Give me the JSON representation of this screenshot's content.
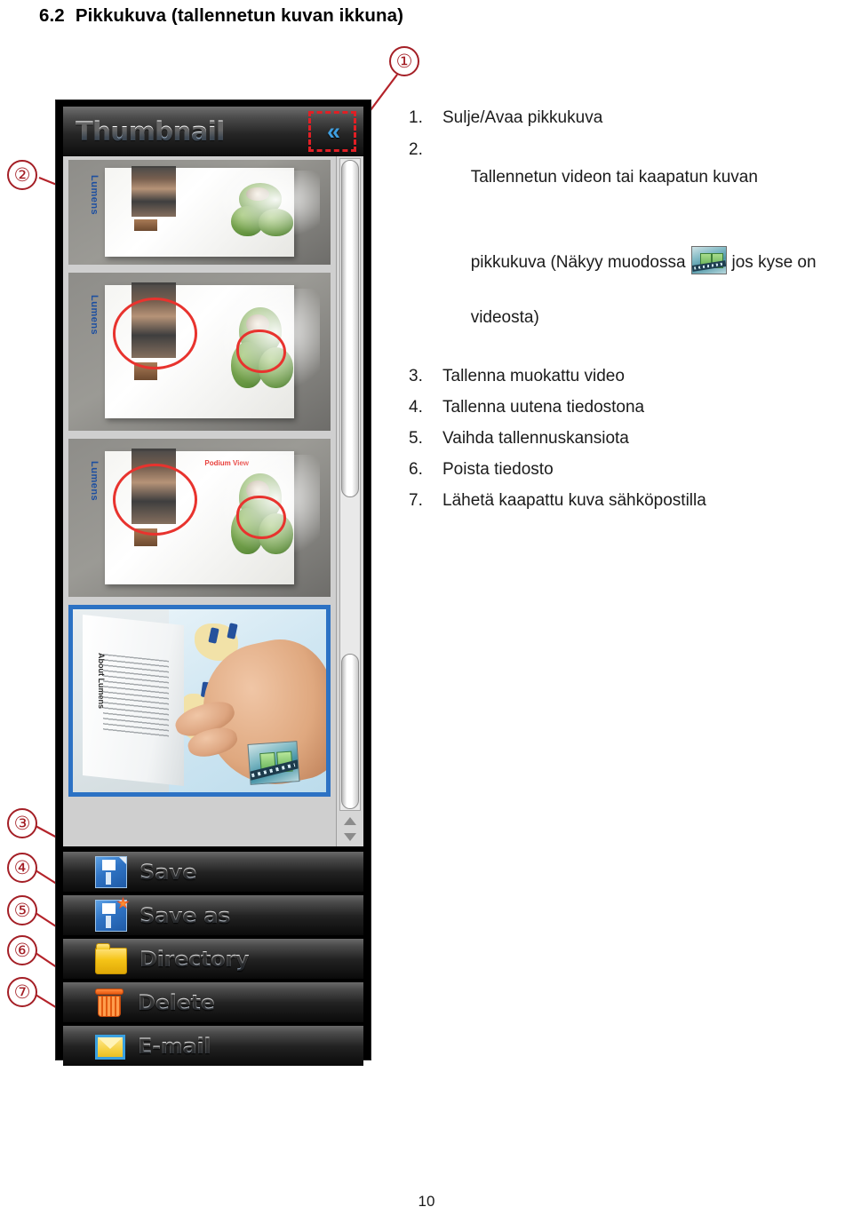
{
  "document": {
    "heading_number": "6.2",
    "heading_text": "Pikkukuva (tallennetun kuvan ikkuna)",
    "page_number": "10"
  },
  "legend": {
    "items": [
      {
        "num": "1.",
        "text": "Sulje/Avaa pikkukuva"
      },
      {
        "num": "2.",
        "text_before": "Tallennetun videon tai kaapatun kuvan",
        "text_mid": "pikkukuva (Näkyy muodossa",
        "badge_icon": "video-filmstrip-icon",
        "text_after": "jos kyse on",
        "text_last": "videosta)"
      },
      {
        "num": "3.",
        "text": "Tallenna muokattu video"
      },
      {
        "num": "4.",
        "text": "Tallenna uutena tiedostona"
      },
      {
        "num": "5.",
        "text": "Vaihda tallennuskansiota"
      },
      {
        "num": "6.",
        "text": "Poista tiedosto"
      },
      {
        "num": "7.",
        "text": "Lähetä kaapattu kuva sähköpostilla"
      }
    ]
  },
  "app": {
    "titlebar": {
      "title": "Thumbnail",
      "collapse_icon": "double-chevron-left-icon",
      "collapse_glyph": "«"
    },
    "thumbnails": [
      {
        "label": "thumbnail-1",
        "selected": false,
        "brand": "Lumens"
      },
      {
        "label": "thumbnail-2",
        "selected": false,
        "brand": "Lumens"
      },
      {
        "label": "thumbnail-3",
        "selected": false,
        "brand": "Lumens",
        "note": "Podium View"
      },
      {
        "label": "thumbnail-4-video",
        "selected": true,
        "caption": "About Lumens",
        "badge_icon": "video-filmstrip-icon"
      }
    ],
    "actions": [
      {
        "label": "Save",
        "icon": "floppy-disk-icon"
      },
      {
        "label": "Save as",
        "icon": "floppy-disk-star-icon"
      },
      {
        "label": "Directory",
        "icon": "folder-icon"
      },
      {
        "label": "Delete",
        "icon": "trash-can-icon"
      },
      {
        "label": "E-mail",
        "icon": "envelope-icon"
      }
    ],
    "scrollbar": {
      "up_arrow_icon": "triangle-up-icon",
      "down_arrow_icon": "triangle-down-icon"
    }
  },
  "callouts": [
    {
      "id": "callout-1",
      "glyph": "①"
    },
    {
      "id": "callout-2",
      "glyph": "②"
    },
    {
      "id": "callout-3",
      "glyph": "③"
    },
    {
      "id": "callout-4",
      "glyph": "④"
    },
    {
      "id": "callout-5",
      "glyph": "⑤"
    },
    {
      "id": "callout-6",
      "glyph": "⑥"
    },
    {
      "id": "callout-7",
      "glyph": "⑦"
    }
  ],
  "colors": {
    "callout_red": "#a41f26",
    "highlight_red": "#e01f25",
    "selection_blue": "#2c72c4",
    "annotation_red": "#e8332e"
  }
}
